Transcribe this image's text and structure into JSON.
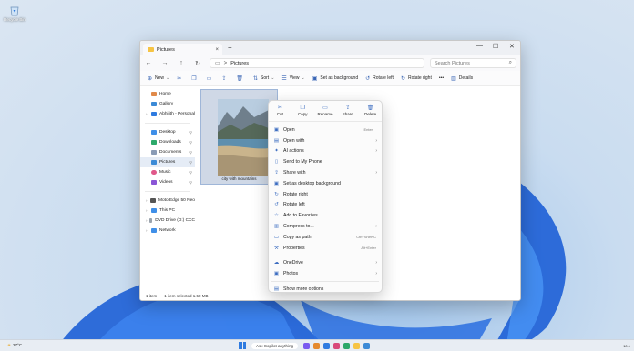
{
  "desktop": {
    "recycle_bin_label": "Recycle Bin"
  },
  "window": {
    "tab_title": "Pictures",
    "tab_close": "×",
    "new_tab": "+",
    "minimize": "—",
    "maximize": "☐",
    "close": "✕",
    "nav": {
      "back": "←",
      "forward": "→",
      "up": "↑",
      "refresh": "↻"
    },
    "breadcrumb": {
      "sep": ">",
      "current": "Pictures"
    },
    "search_placeholder": "Search Pictures",
    "toolbar": {
      "new_label": "New",
      "sort_label": "Sort",
      "view_label": "View",
      "set_background_label": "Set as background",
      "rotate_left_label": "Rotate left",
      "rotate_right_label": "Rotate right",
      "more_label": "•••",
      "details_label": "Details"
    },
    "sidebar": {
      "group1": [
        "Home",
        "Gallery",
        "Abhijith - Personal"
      ],
      "group2": [
        "Desktop",
        "Downloads",
        "Documents",
        "Pictures",
        "Music",
        "Videos"
      ],
      "group3": [
        "Moto Edge 50 Neo",
        "This PC",
        "DVD Drive (D:) CCC",
        "Network"
      ]
    },
    "file": {
      "name": "city with mountains"
    },
    "status": {
      "count": "1 item",
      "selected": "1 item selected  1.52 MB"
    }
  },
  "context_menu": {
    "top_actions": [
      "Cut",
      "Copy",
      "Rename",
      "Share",
      "Delete"
    ],
    "items": [
      {
        "label": "Open",
        "accel": "Enter",
        "submenu": false
      },
      {
        "label": "Open with",
        "accel": "",
        "submenu": true
      },
      {
        "label": "AI actions",
        "accel": "",
        "submenu": true
      },
      {
        "label": "Send to My Phone",
        "accel": "",
        "submenu": false
      },
      {
        "label": "Share with",
        "accel": "",
        "submenu": true
      },
      {
        "label": "Set as desktop background",
        "accel": "",
        "submenu": false
      },
      {
        "label": "Rotate right",
        "accel": "",
        "submenu": false
      },
      {
        "label": "Rotate left",
        "accel": "",
        "submenu": false
      },
      {
        "label": "Add to Favorites",
        "accel": "",
        "submenu": false
      },
      {
        "label": "Compress to...",
        "accel": "",
        "submenu": true
      },
      {
        "label": "Copy as path",
        "accel": "Ctrl+Shift+C",
        "submenu": false
      },
      {
        "label": "Properties",
        "accel": "Alt+Enter",
        "submenu": false
      }
    ],
    "items2": [
      {
        "label": "OneDrive",
        "submenu": true
      },
      {
        "label": "Photos",
        "submenu": true
      }
    ],
    "more": "Show more options"
  },
  "taskbar": {
    "temperature": "27°C",
    "search_placeholder": "Ask Copilot anything",
    "time": "10:1"
  },
  "colors": {
    "accent": "#2f7be0",
    "folder": "#f6c445"
  }
}
